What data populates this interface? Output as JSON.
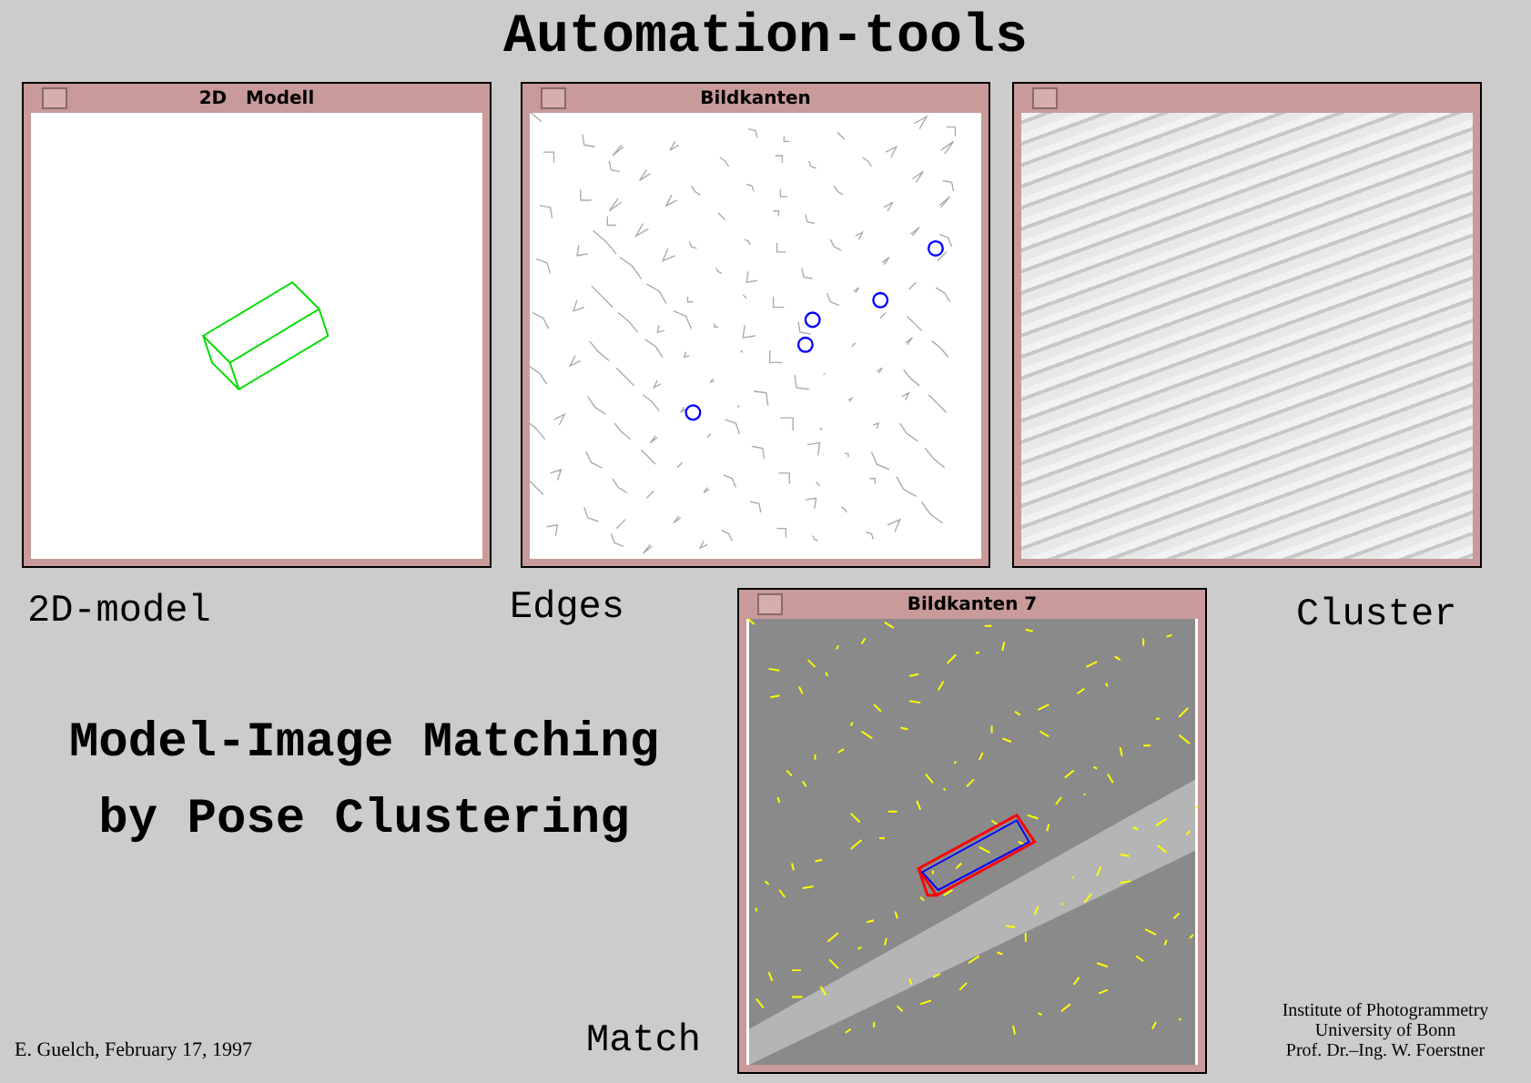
{
  "title": "Automation-tools",
  "windows": [
    {
      "title": "2D   Modell",
      "kind": "model"
    },
    {
      "title": "Bildkanten",
      "kind": "edges"
    },
    {
      "kind": "cluster"
    },
    {
      "title": "Bildkanten 7",
      "kind": "match"
    }
  ],
  "captions": [
    "2D-model",
    "Edges",
    "Cluster",
    "Match"
  ],
  "heading": [
    "Model-Image Matching",
    "by Pose Clustering"
  ],
  "author": "E. Guelch, February 17, 1997",
  "institute": [
    "Institute of Photogrammetry",
    "University of Bonn",
    "Prof. Dr.–Ing. W. Foerstner"
  ]
}
